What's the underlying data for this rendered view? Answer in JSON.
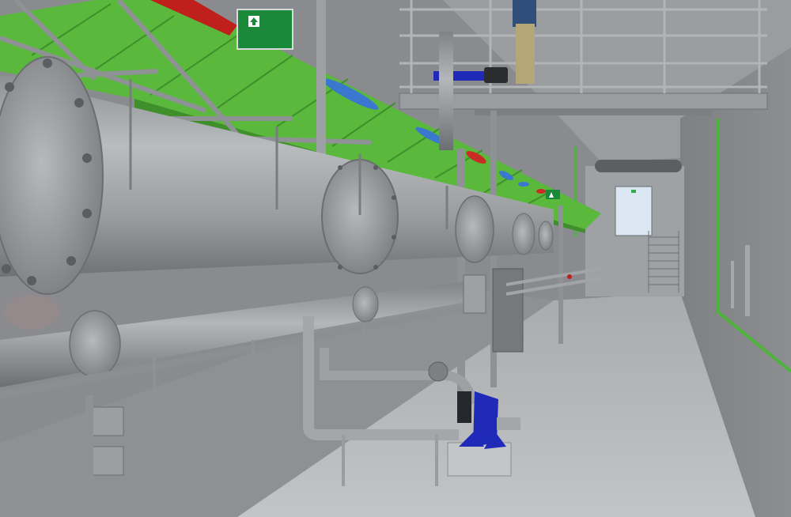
{
  "scene": {
    "type": "3d-cad-render",
    "subject": "industrial-pipe-corridor",
    "colors": {
      "background_wall": "#8b8d8f",
      "floor": "#b9bbbd",
      "ceiling": "#9ea1a4",
      "pipe": "#a4a7aa",
      "pipe_dark": "#7d8083",
      "cable_tray": "#5ab83c",
      "cable_tray_dark": "#3f8f2a",
      "red_pipe": "#c0201c",
      "blue_pipe": "#3a78d0",
      "pump_blue": "#1f2bb8",
      "exit_sign": "#1a8a3a",
      "door_light": "#d8e6f4"
    },
    "signs": [
      {
        "icon": "arrow-up-icon",
        "label": ""
      },
      {
        "icon": "arrow-up-icon",
        "label": ""
      }
    ]
  }
}
